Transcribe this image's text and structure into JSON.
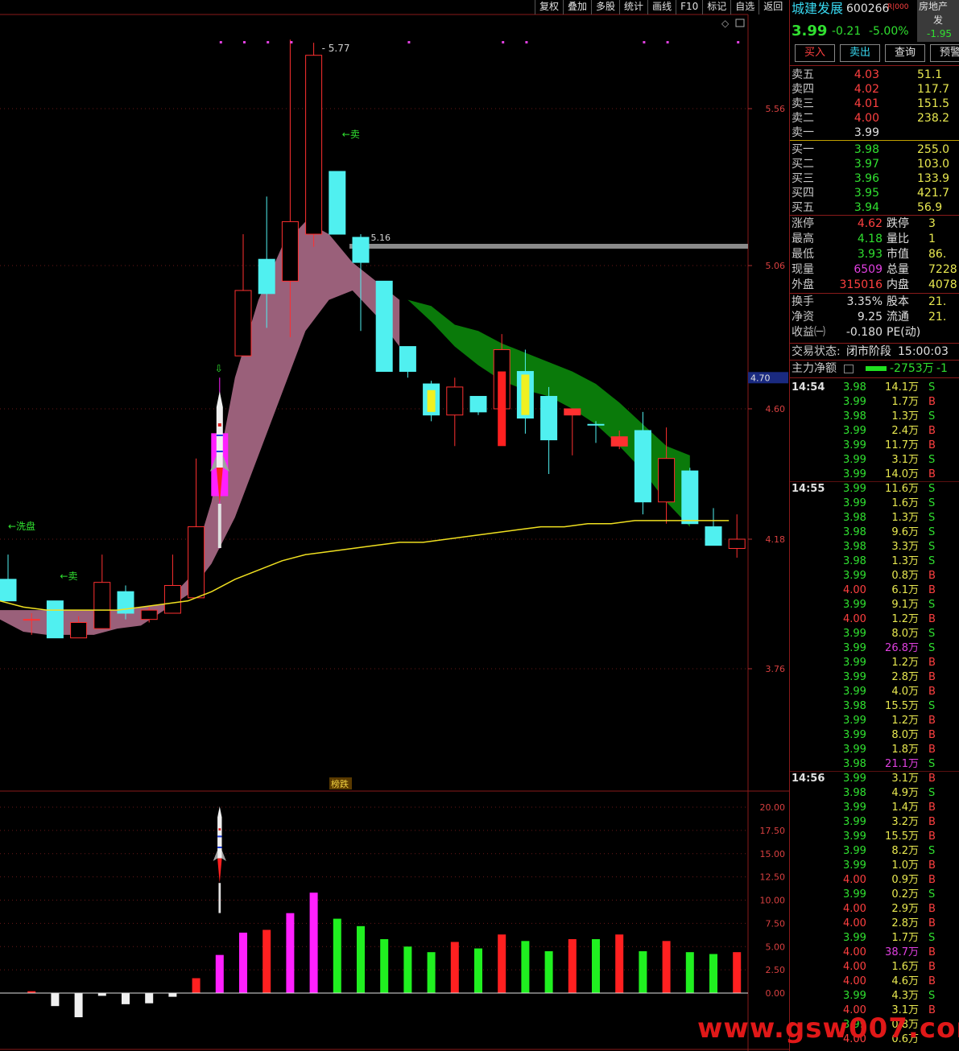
{
  "toolbar": [
    "复权",
    "叠加",
    "多股",
    "统计",
    "画线",
    "F10",
    "标记",
    "自选",
    "返回"
  ],
  "stock": {
    "name": "城建发展",
    "code": "600266",
    "tag": "R|000",
    "price": "3.99",
    "change": "-0.21",
    "pct": "-5.00%",
    "sector": "房地产",
    "sector_sub": "发",
    "sector_pct": "-1.95"
  },
  "buttons": [
    "买入",
    "卖出",
    "查询",
    "预警"
  ],
  "asks": [
    {
      "label": "卖五",
      "price": "4.03",
      "vol": "51.1"
    },
    {
      "label": "卖四",
      "price": "4.02",
      "vol": "117.7"
    },
    {
      "label": "卖三",
      "price": "4.01",
      "vol": "151.5"
    },
    {
      "label": "卖二",
      "price": "4.00",
      "vol": "238.2"
    },
    {
      "label": "卖一",
      "price": "3.99",
      "vol": ""
    }
  ],
  "bids": [
    {
      "label": "买一",
      "price": "3.98",
      "vol": "255.0"
    },
    {
      "label": "买二",
      "price": "3.97",
      "vol": "103.0"
    },
    {
      "label": "买三",
      "price": "3.96",
      "vol": "133.9"
    },
    {
      "label": "买四",
      "price": "3.95",
      "vol": "421.7"
    },
    {
      "label": "买五",
      "price": "3.94",
      "vol": "56.9"
    }
  ],
  "stats1": [
    {
      "l": "涨停",
      "v": "4.62",
      "c": "red",
      "l2": "跌停",
      "v2": "3"
    },
    {
      "l": "最高",
      "v": "4.18",
      "c": "green",
      "l2": "量比",
      "v2": "1"
    },
    {
      "l": "最低",
      "v": "3.93",
      "c": "green",
      "l2": "市值",
      "v2": "86."
    },
    {
      "l": "现量",
      "v": "6509",
      "c": "mag",
      "l2": "总量",
      "v2": "7228"
    },
    {
      "l": "外盘",
      "v": "315016",
      "c": "red",
      "l2": "内盘",
      "v2": "4078"
    }
  ],
  "stats2": [
    {
      "l": "换手",
      "v": "3.35%",
      "c": "white",
      "l2": "股本",
      "v2": "21."
    },
    {
      "l": "净资",
      "v": "9.25",
      "c": "white",
      "l2": "流通",
      "v2": "21."
    },
    {
      "l": "收益㈠",
      "v": "-0.180",
      "c": "white",
      "l2": "PE(动)",
      "v2": ""
    }
  ],
  "status": {
    "label": "交易状态:",
    "value": "闭市阶段",
    "time": "15:00:03"
  },
  "main_money": {
    "label": "主力净额",
    "value": "-2753万",
    "tail": "-1"
  },
  "ticks": [
    {
      "t": "14:54",
      "p": "3.98",
      "q": "14.1万",
      "d": "S"
    },
    {
      "t": "",
      "p": "3.99",
      "q": "1.7万",
      "d": "B"
    },
    {
      "t": "",
      "p": "3.98",
      "q": "1.3万",
      "d": "S"
    },
    {
      "t": "",
      "p": "3.99",
      "q": "2.4万",
      "d": "B"
    },
    {
      "t": "",
      "p": "3.99",
      "q": "11.7万",
      "d": "B"
    },
    {
      "t": "",
      "p": "3.99",
      "q": "3.1万",
      "d": "S"
    },
    {
      "t": "",
      "p": "3.99",
      "q": "14.0万",
      "d": "B"
    },
    {
      "t": "14:55",
      "p": "3.99",
      "q": "11.6万",
      "d": "S"
    },
    {
      "t": "",
      "p": "3.99",
      "q": "1.6万",
      "d": "S"
    },
    {
      "t": "",
      "p": "3.98",
      "q": "1.3万",
      "d": "S"
    },
    {
      "t": "",
      "p": "3.98",
      "q": "9.6万",
      "d": "S"
    },
    {
      "t": "",
      "p": "3.98",
      "q": "3.3万",
      "d": "S"
    },
    {
      "t": "",
      "p": "3.98",
      "q": "1.3万",
      "d": "S"
    },
    {
      "t": "",
      "p": "3.99",
      "q": "0.8万",
      "d": "B"
    },
    {
      "t": "",
      "p": "4.00",
      "q": "6.1万",
      "d": "B"
    },
    {
      "t": "",
      "p": "3.99",
      "q": "9.1万",
      "d": "S"
    },
    {
      "t": "",
      "p": "4.00",
      "q": "1.2万",
      "d": "B"
    },
    {
      "t": "",
      "p": "3.99",
      "q": "8.0万",
      "d": "S"
    },
    {
      "t": "",
      "p": "3.99",
      "q": "26.8万",
      "d": "S"
    },
    {
      "t": "",
      "p": "3.99",
      "q": "1.2万",
      "d": "B"
    },
    {
      "t": "",
      "p": "3.99",
      "q": "2.8万",
      "d": "B"
    },
    {
      "t": "",
      "p": "3.99",
      "q": "4.0万",
      "d": "B"
    },
    {
      "t": "",
      "p": "3.98",
      "q": "15.5万",
      "d": "S"
    },
    {
      "t": "",
      "p": "3.99",
      "q": "1.2万",
      "d": "B"
    },
    {
      "t": "",
      "p": "3.99",
      "q": "8.0万",
      "d": "B"
    },
    {
      "t": "",
      "p": "3.99",
      "q": "1.8万",
      "d": "B"
    },
    {
      "t": "",
      "p": "3.98",
      "q": "21.1万",
      "d": "S"
    },
    {
      "t": "14:56",
      "p": "3.99",
      "q": "3.1万",
      "d": "B"
    },
    {
      "t": "",
      "p": "3.98",
      "q": "4.9万",
      "d": "S"
    },
    {
      "t": "",
      "p": "3.99",
      "q": "1.4万",
      "d": "B"
    },
    {
      "t": "",
      "p": "3.99",
      "q": "3.2万",
      "d": "B"
    },
    {
      "t": "",
      "p": "3.99",
      "q": "15.5万",
      "d": "B"
    },
    {
      "t": "",
      "p": "3.99",
      "q": "8.2万",
      "d": "S"
    },
    {
      "t": "",
      "p": "3.99",
      "q": "1.0万",
      "d": "B"
    },
    {
      "t": "",
      "p": "4.00",
      "q": "0.9万",
      "d": "B"
    },
    {
      "t": "",
      "p": "3.99",
      "q": "0.2万",
      "d": "S"
    },
    {
      "t": "",
      "p": "4.00",
      "q": "2.9万",
      "d": "B"
    },
    {
      "t": "",
      "p": "4.00",
      "q": "2.8万",
      "d": "B"
    },
    {
      "t": "",
      "p": "3.99",
      "q": "1.7万",
      "d": "S"
    },
    {
      "t": "",
      "p": "4.00",
      "q": "38.7万",
      "d": "B"
    },
    {
      "t": "",
      "p": "4.00",
      "q": "1.6万",
      "d": "B"
    },
    {
      "t": "",
      "p": "4.00",
      "q": "4.6万",
      "d": "B"
    },
    {
      "t": "",
      "p": "3.99",
      "q": "4.3万",
      "d": "S"
    },
    {
      "t": "",
      "p": "4.00",
      "q": "3.1万",
      "d": "B"
    },
    {
      "t": "",
      "p": "3.99",
      "q": "0.8万",
      "d": ""
    },
    {
      "t": "",
      "p": "4.00",
      "q": "0.6万",
      "d": ""
    }
  ],
  "watermark": "www.gsw007.com",
  "chart_data": [
    {
      "type": "candlestick",
      "title": "",
      "y_ticks": [
        "5.56",
        "5.06",
        "4.60",
        "4.18",
        "3.76"
      ],
      "current_price_tag": "4.70",
      "annotations": [
        {
          "text": "5.77",
          "at": "high"
        },
        {
          "text": "5.16",
          "at": "resistance line"
        },
        {
          "text": "←卖",
          "near": "high"
        },
        {
          "text": "←洗盘",
          "near": "left"
        },
        {
          "text": "←卖",
          "near": "left"
        },
        {
          "text": "⇩",
          "near": "signal"
        }
      ],
      "candles": [
        {
          "o": 4.05,
          "h": 4.13,
          "l": 3.98,
          "c": 3.98,
          "col": "cyan"
        },
        {
          "o": 3.92,
          "h": 3.94,
          "l": 3.87,
          "c": 3.92,
          "col": "red"
        },
        {
          "o": 3.98,
          "h": 3.98,
          "l": 3.86,
          "c": 3.86,
          "col": "cyan"
        },
        {
          "o": 3.86,
          "h": 3.93,
          "l": 3.86,
          "c": 3.91,
          "col": "red"
        },
        {
          "o": 3.89,
          "h": 4.13,
          "l": 3.89,
          "c": 4.04,
          "col": "red"
        },
        {
          "o": 4.01,
          "h": 4.03,
          "l": 3.92,
          "c": 3.94,
          "col": "cyan"
        },
        {
          "o": 3.92,
          "h": 3.96,
          "l": 3.91,
          "c": 3.95,
          "col": "red"
        },
        {
          "o": 3.94,
          "h": 4.13,
          "l": 3.94,
          "c": 4.03,
          "col": "red"
        },
        {
          "o": 3.99,
          "h": 4.44,
          "l": 3.99,
          "c": 4.22,
          "col": "red"
        },
        {
          "o": 4.32,
          "h": 4.7,
          "l": 4.15,
          "c": 4.52,
          "col": "mag"
        },
        {
          "o": 4.77,
          "h": 5.16,
          "l": 4.77,
          "c": 4.98,
          "col": "red"
        },
        {
          "o": 5.08,
          "h": 5.28,
          "l": 4.86,
          "c": 4.97,
          "col": "cyan"
        },
        {
          "o": 5.01,
          "h": 5.78,
          "l": 4.83,
          "c": 5.2,
          "col": "red"
        },
        {
          "o": 5.16,
          "h": 5.77,
          "l": 5.12,
          "c": 5.73,
          "col": "red"
        },
        {
          "o": 5.36,
          "h": 5.36,
          "l": 5.16,
          "c": 5.16,
          "col": "cyan"
        },
        {
          "o": 5.15,
          "h": 5.16,
          "l": 4.85,
          "c": 5.07,
          "col": "cyan"
        },
        {
          "o": 5.01,
          "h": 5.01,
          "l": 4.72,
          "c": 4.72,
          "col": "cyan"
        },
        {
          "o": 4.8,
          "h": 4.8,
          "l": 4.7,
          "c": 4.72,
          "col": "cyan"
        },
        {
          "o": 4.68,
          "h": 4.69,
          "l": 4.56,
          "c": 4.58,
          "col": "cyan"
        },
        {
          "o": 4.58,
          "h": 4.7,
          "l": 4.48,
          "c": 4.67,
          "col": "red"
        },
        {
          "o": 4.64,
          "h": 4.64,
          "l": 4.58,
          "c": 4.59,
          "col": "cyan"
        },
        {
          "o": 4.6,
          "h": 4.84,
          "l": 4.53,
          "c": 4.79,
          "col": "red"
        },
        {
          "o": 4.72,
          "h": 4.79,
          "l": 4.52,
          "c": 4.57,
          "col": "cyan"
        },
        {
          "o": 4.64,
          "h": 4.67,
          "l": 4.39,
          "c": 4.5,
          "col": "cyan"
        },
        {
          "o": 4.6,
          "h": 4.6,
          "l": 4.45,
          "c": 4.58,
          "col": "red"
        },
        {
          "o": 4.55,
          "h": 4.56,
          "l": 4.49,
          "c": 4.55,
          "col": "cyan"
        },
        {
          "o": 4.51,
          "h": 4.53,
          "l": 4.47,
          "c": 4.48,
          "col": "red"
        },
        {
          "o": 4.53,
          "h": 4.59,
          "l": 4.26,
          "c": 4.3,
          "col": "cyan"
        },
        {
          "o": 4.3,
          "h": 4.54,
          "l": 4.23,
          "c": 4.44,
          "col": "red"
        },
        {
          "o": 4.4,
          "h": 4.41,
          "l": 4.23,
          "c": 4.23,
          "col": "cyan"
        },
        {
          "o": 4.22,
          "h": 4.28,
          "l": 4.16,
          "c": 4.16,
          "col": "cyan"
        },
        {
          "o": 4.15,
          "h": 4.26,
          "l": 4.12,
          "c": 4.18,
          "col": "red"
        }
      ],
      "yellow_ma": [
        3.98,
        3.96,
        3.95,
        3.95,
        3.95,
        3.95,
        3.96,
        3.97,
        3.98,
        4.01,
        4.05,
        4.08,
        4.11,
        4.13,
        4.14,
        4.15,
        4.16,
        4.17,
        4.17,
        4.18,
        4.19,
        4.2,
        4.21,
        4.22,
        4.22,
        4.23,
        4.23,
        4.24,
        4.24,
        4.24,
        4.24,
        4.24
      ],
      "bands": [
        {
          "color": "pink",
          "upper": [
            3.95,
            3.95,
            3.95,
            3.95,
            3.95,
            3.95,
            3.96,
            3.97,
            4.05,
            4.3,
            4.7,
            4.95,
            5.12,
            5.2,
            5.16,
            5.07,
            5.01,
            4.95
          ],
          "lower": [
            3.92,
            3.88,
            3.87,
            3.87,
            3.87,
            3.89,
            3.9,
            3.95,
            4.0,
            4.1,
            4.25,
            4.45,
            4.65,
            4.85,
            4.95,
            4.98,
            4.9,
            4.8
          ]
        },
        {
          "color": "green",
          "upper": [
            4.95,
            4.93,
            4.87,
            4.85,
            4.81,
            4.78,
            4.75,
            4.72,
            4.68,
            4.62,
            4.55,
            4.48,
            4.45
          ],
          "lower": [
            4.95,
            4.88,
            4.8,
            4.74,
            4.69,
            4.66,
            4.64,
            4.6,
            4.55,
            4.48,
            4.4,
            4.3,
            4.22
          ]
        }
      ]
    },
    {
      "type": "bar",
      "title": "榜跌",
      "y_ticks": [
        "20.00",
        "17.50",
        "15.00",
        "12.50",
        "10.00",
        "7.50",
        "5.00",
        "2.50",
        "0.00"
      ],
      "values": [
        0,
        0.2,
        -1.4,
        -2.6,
        -0.3,
        -1.2,
        -1.1,
        -0.4,
        1.6,
        4.1,
        6.5,
        6.8,
        8.6,
        10.8,
        8.0,
        7.2,
        5.8,
        5.0,
        4.4,
        5.5,
        4.8,
        6.3,
        5.6,
        4.5,
        5.8,
        5.8,
        6.3,
        4.5,
        5.6,
        4.4,
        4.2,
        4.4
      ],
      "colors": [
        "white",
        "red",
        "white",
        "white",
        "white",
        "white",
        "white",
        "white",
        "red",
        "mag",
        "mag",
        "red",
        "mag",
        "mag",
        "green",
        "green",
        "green",
        "green",
        "green",
        "red",
        "green",
        "red",
        "green",
        "green",
        "red",
        "green",
        "red",
        "green",
        "red",
        "green",
        "green",
        "red"
      ]
    }
  ]
}
